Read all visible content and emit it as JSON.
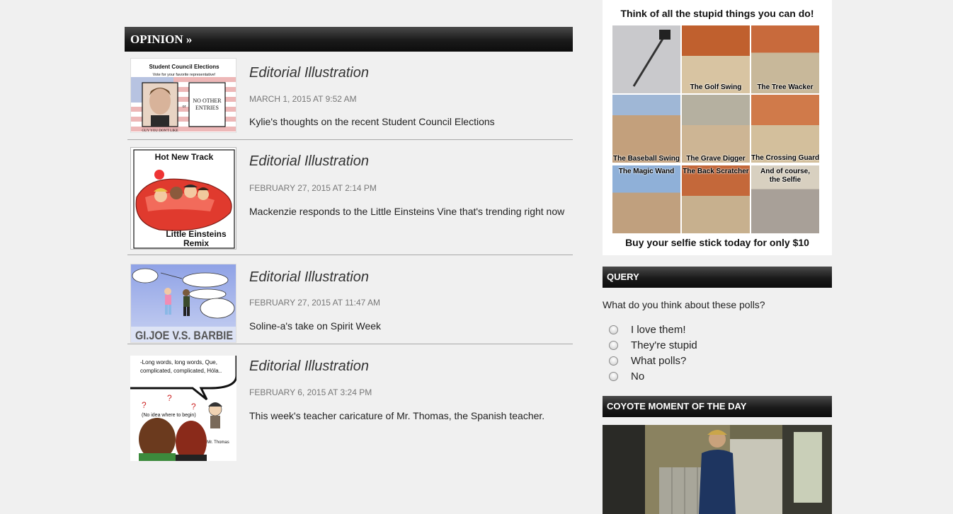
{
  "opinion": {
    "header": "OPINION »",
    "articles": [
      {
        "title": "Editorial Illustration",
        "date": "MARCH 1, 2015 AT 9:52 AM",
        "desc": "Kylie's thoughts on the recent Student Council Elections",
        "thumb": {
          "heading": "Student Council Elections",
          "sub": "Vote for your favorite representative!",
          "or": "or",
          "box": [
            "NO OTHER",
            "ENTRIES"
          ],
          "caption": "GUY YOU DON'T LIKE"
        }
      },
      {
        "title": "Editorial Illustration",
        "date": "FEBRUARY 27, 2015 AT 2:14 PM",
        "desc": "Mackenzie responds to the Little Einsteins Vine that's trending right now",
        "thumb": {
          "top": "Hot New Track",
          "bottom1": "Little Einsteins",
          "bottom2": "Remix"
        }
      },
      {
        "title": "Editorial Illustration",
        "date": "FEBRUARY 27, 2015 AT 11:47 AM",
        "desc": "Soline-a's take on Spirit Week",
        "thumb": {
          "caption": "GI.JOE V.S. BARBIE"
        }
      },
      {
        "title": "Editorial Illustration",
        "date": "FEBRUARY 6, 2015 AT 3:24 PM",
        "desc": "This week's teacher caricature of Mr. Thomas, the Spanish teacher.",
        "thumb": {
          "bubble1": "-Long words, long words, Que,",
          "bubble2": "complicated, complicated, Hóla..",
          "note": "(No idea where to begin)",
          "name": "Mr. Thomas"
        }
      }
    ]
  },
  "ad": {
    "title": "Think of all the stupid things you can do!",
    "footer": "Buy your selfie stick today for only $10",
    "captions": [
      "The Golf Swing",
      "The Tree Wacker",
      "The Baseball Swing",
      "The Grave Digger",
      "The Crossing Guard",
      "The Magic Wand",
      "The Back Scratcher",
      "And of course,",
      "the Selfie"
    ]
  },
  "query": {
    "header": "QUERY",
    "question": "What do you think about these polls?",
    "options": [
      "I love them!",
      "They're stupid",
      "What polls?",
      "No"
    ]
  },
  "moment": {
    "header": "COYOTE MOMENT OF THE DAY"
  }
}
